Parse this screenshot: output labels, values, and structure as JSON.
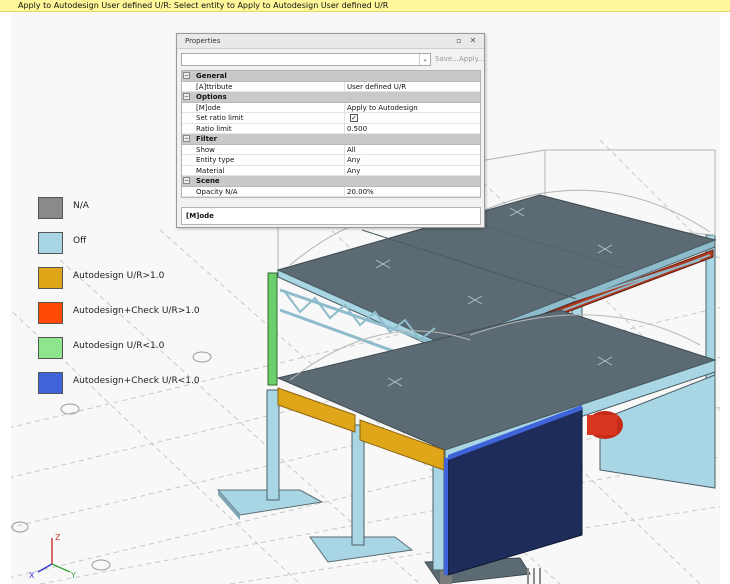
{
  "prompt": "Apply to Autodesign User defined U/R: Select entity to Apply to Autodesign User defined U/R",
  "legend": [
    {
      "label": "N/A",
      "color": "#8a8a8a"
    },
    {
      "label": "Off",
      "color": "#a9d6e5"
    },
    {
      "label": "Autodesign U/R>1.0",
      "color": "#e0a61a"
    },
    {
      "label": "Autodesign+Check U/R>1.0",
      "color": "#ff4a05"
    },
    {
      "label": "Autodesign U/R<1.0",
      "color": "#8ee58e"
    },
    {
      "label": "Autodesign+Check U/R<1.0",
      "color": "#3f63d8"
    }
  ],
  "properties": {
    "title": "Properties",
    "combo_value": "",
    "save_label": "Save...",
    "apply_label": "Apply...",
    "sections": {
      "general": "General",
      "options": "Options",
      "filter": "Filter",
      "scene": "Scene"
    },
    "rows": {
      "attribute": {
        "label": "[A]ttribute",
        "value": "User defined U/R"
      },
      "mode": {
        "label": "[M]ode",
        "value": "Apply to Autodesign"
      },
      "set_ratio_limit": {
        "label": "Set ratio limit",
        "checked": true
      },
      "ratio_limit": {
        "label": "Ratio limit",
        "value": "0.500"
      },
      "show": {
        "label": "Show",
        "value": "All"
      },
      "entity_type": {
        "label": "Entity type",
        "value": "Any"
      },
      "material": {
        "label": "Material",
        "value": "Any"
      },
      "opacity": {
        "label": "Opacity N/A",
        "value": "20.00%"
      }
    },
    "description": "[M]ode"
  },
  "axis": {
    "x": "X",
    "y": "Y",
    "z": "Z"
  },
  "colors": {
    "slab_top": "#5c6b73",
    "slab_side": "#a9d6e5",
    "steel": "#4f6f7b",
    "na_gray": "#8a8a8a"
  }
}
